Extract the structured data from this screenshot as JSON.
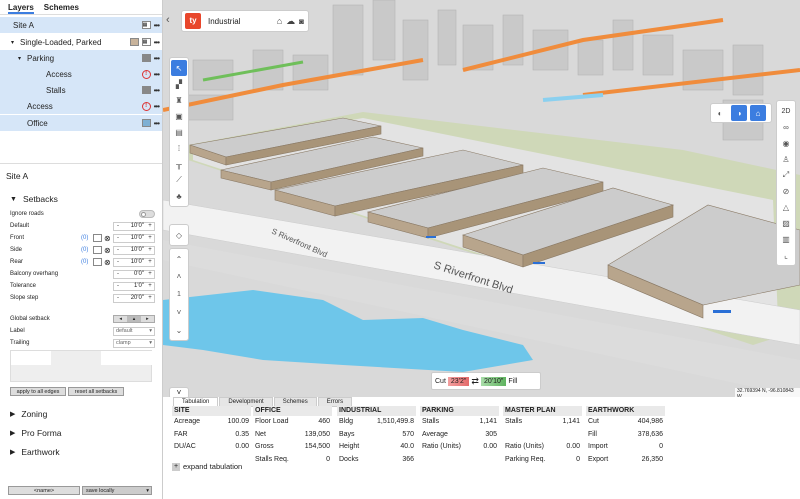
{
  "sidebar": {
    "tabs": [
      "Layers",
      "Schemes"
    ],
    "layers": [
      {
        "label": "Site A",
        "indent": 0,
        "selected": true,
        "caret": "",
        "color": null,
        "warn": false
      },
      {
        "label": "Single-Loaded, Parked",
        "indent": 1,
        "selected": false,
        "caret": "▾",
        "color": "#c8b39b",
        "warn": false
      },
      {
        "label": "Parking",
        "indent": 2,
        "selected": true,
        "caret": "▾",
        "color": "#888888",
        "warn": false
      },
      {
        "label": "Access",
        "indent": 3,
        "selected": true,
        "caret": "",
        "color": null,
        "warn": true
      },
      {
        "label": "Stalls",
        "indent": 3,
        "selected": true,
        "caret": "",
        "color": "#888888",
        "warn": false
      },
      {
        "label": "Access",
        "indent": 2,
        "selected": true,
        "caret": "",
        "color": null,
        "warn": true
      },
      {
        "label": "Office",
        "indent": 2,
        "selected": true,
        "caret": "",
        "color": "#7eb0d4",
        "warn": false
      }
    ],
    "properties_title": "Site A",
    "setbacks": {
      "title": "Setbacks",
      "ignore_roads": "Ignore roads",
      "rows": [
        {
          "label": "Default",
          "value": "10'0\"",
          "extra": ""
        },
        {
          "label": "Front",
          "value": "10'0\"",
          "extra": "(0)"
        },
        {
          "label": "Side",
          "value": "10'0\"",
          "extra": "(0)"
        },
        {
          "label": "Rear",
          "value": "10'0\"",
          "extra": "(0)"
        },
        {
          "label": "Balcony overhang",
          "value": "0'0\"",
          "extra": ""
        },
        {
          "label": "Tolerance",
          "value": "1'0\"",
          "extra": ""
        },
        {
          "label": "Slope step",
          "value": "20'0\"",
          "extra": ""
        }
      ],
      "global_setback": "Global setback",
      "label_label": "Label",
      "label_value": "default",
      "trailing_label": "Trailing",
      "trailing_value": "clamp",
      "apply_btn": "apply to all edges",
      "reset_btn": "reset all setbacks"
    },
    "sections": [
      "Zoning",
      "Pro Forma",
      "Earthwork"
    ],
    "footer": {
      "name_btn": "<name>",
      "save_btn": "save locally"
    }
  },
  "map": {
    "project_title": "Industrial",
    "street_label_1": "S Riverfront Blvd",
    "street_label_2": "S Riverfront Blvd",
    "view_2d": "2D",
    "page_number": "1",
    "cut_label": "Cut",
    "cut_value": "23'2\"",
    "fill_label": "Fill",
    "fill_value": "20'10\"",
    "coords": "32.769394 N, -96.810843 W"
  },
  "bottom": {
    "tabs": [
      "Tabulation",
      "Development",
      "Schemes",
      "Errors"
    ],
    "columns": [
      {
        "header": "SITE",
        "rows": [
          [
            "Acreage",
            "100.09"
          ],
          [
            "FAR",
            "0.35"
          ],
          [
            "DU/AC",
            "0.00"
          ]
        ]
      },
      {
        "header": "OFFICE",
        "rows": [
          [
            "Floor Load",
            "460"
          ],
          [
            "Net",
            "139,050"
          ],
          [
            "Gross",
            "154,500"
          ],
          [
            "Stalls Req.",
            "0"
          ]
        ]
      },
      {
        "header": "INDUSTRIAL",
        "rows": [
          [
            "Bldg",
            "1,510,499.8"
          ],
          [
            "Bays",
            "570"
          ],
          [
            "Height",
            "40.0"
          ],
          [
            "Docks",
            "366"
          ]
        ]
      },
      {
        "header": "PARKING",
        "rows": [
          [
            "Stalls",
            "1,141"
          ],
          [
            "Average",
            "305"
          ],
          [
            "Ratio (Units)",
            "0.00"
          ]
        ]
      },
      {
        "header": "MASTER PLAN",
        "rows": [
          [
            "Stalls",
            "1,141"
          ],
          [
            "",
            ""
          ],
          [
            "Ratio (Units)",
            "0.00"
          ],
          [
            "Parking Req.",
            "0"
          ]
        ]
      },
      {
        "header": "EARTHWORK",
        "rows": [
          [
            "Cut",
            "404,986"
          ],
          [
            "Fill",
            "378,636"
          ],
          [
            "Import",
            "0"
          ],
          [
            "Export",
            "26,350"
          ]
        ]
      }
    ],
    "expand_label": "expand tabulation"
  },
  "colors": {
    "accent": "#3b7de0",
    "logo": "#e8462b",
    "cut": "#e46a6a",
    "fill": "#5fb35f",
    "water": "#6ec6ea"
  }
}
